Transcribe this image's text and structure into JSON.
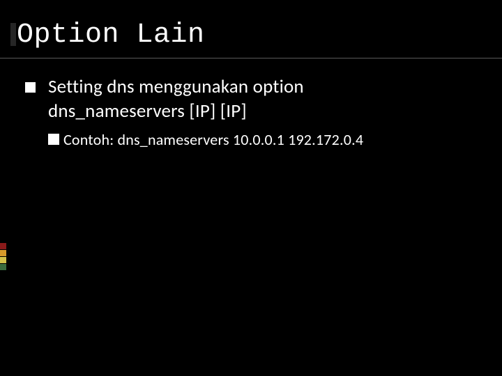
{
  "title": "Option Lain",
  "bullet": {
    "line1": "Setting dns menggunakan option",
    "line2": "dns_nameservers [IP] [IP]"
  },
  "sub_bullet": "Contoh: dns_nameservers 10.0.0.1 192.172.0.4",
  "accent_colors": [
    "#8b1a1a",
    "#d89a2b",
    "#d4c24a",
    "#3a6b3e"
  ]
}
